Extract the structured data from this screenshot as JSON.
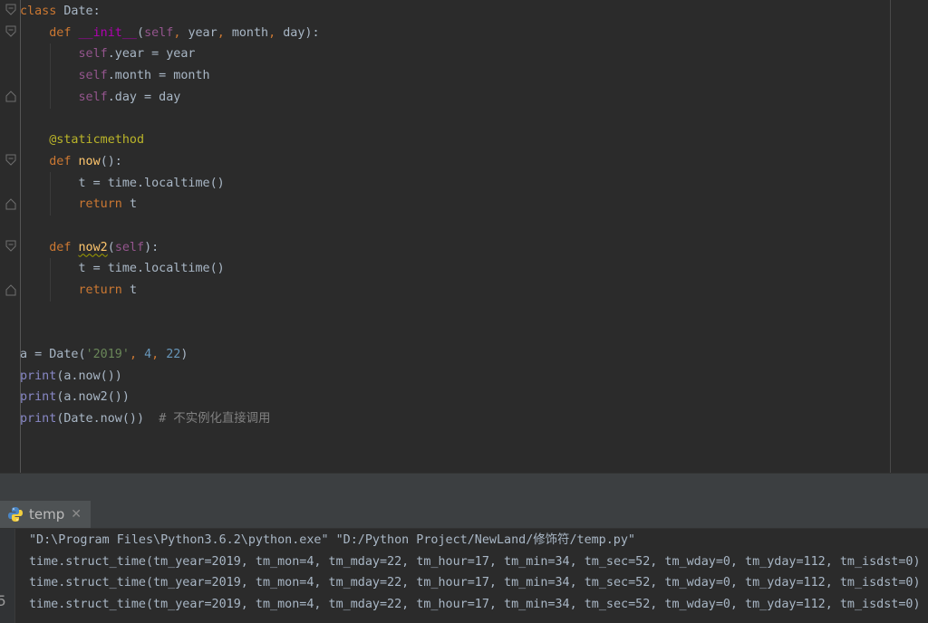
{
  "editor": {
    "lines": [
      [
        {
          "t": "class ",
          "c": "kw"
        },
        {
          "t": "Date:",
          "c": "txt"
        }
      ],
      [
        {
          "t": "    ",
          "c": "txt"
        },
        {
          "t": "def ",
          "c": "kw"
        },
        {
          "t": "__init__",
          "c": "magic"
        },
        {
          "t": "(",
          "c": "txt"
        },
        {
          "t": "self",
          "c": "self"
        },
        {
          "t": ", ",
          "c": "kw"
        },
        {
          "t": "year",
          "c": "txt"
        },
        {
          "t": ", ",
          "c": "kw"
        },
        {
          "t": "month",
          "c": "txt"
        },
        {
          "t": ", ",
          "c": "kw"
        },
        {
          "t": "day):",
          "c": "txt"
        }
      ],
      [
        {
          "t": "        ",
          "c": "txt"
        },
        {
          "t": "self",
          "c": "self"
        },
        {
          "t": ".year = year",
          "c": "txt"
        }
      ],
      [
        {
          "t": "        ",
          "c": "txt"
        },
        {
          "t": "self",
          "c": "self"
        },
        {
          "t": ".month = month",
          "c": "txt"
        }
      ],
      [
        {
          "t": "        ",
          "c": "txt"
        },
        {
          "t": "self",
          "c": "self"
        },
        {
          "t": ".day = day",
          "c": "txt"
        }
      ],
      [],
      [
        {
          "t": "    ",
          "c": "txt"
        },
        {
          "t": "@staticmethod",
          "c": "deco"
        }
      ],
      [
        {
          "t": "    ",
          "c": "txt"
        },
        {
          "t": "def ",
          "c": "kw"
        },
        {
          "t": "now",
          "c": "fn"
        },
        {
          "t": "():",
          "c": "txt"
        }
      ],
      [
        {
          "t": "        t = time.localtime()",
          "c": "txt"
        }
      ],
      [
        {
          "t": "        ",
          "c": "txt"
        },
        {
          "t": "return ",
          "c": "kw"
        },
        {
          "t": "t",
          "c": "txt"
        }
      ],
      [],
      [
        {
          "t": "    ",
          "c": "txt"
        },
        {
          "t": "def ",
          "c": "kw"
        },
        {
          "t": "now2",
          "c": "fn warn"
        },
        {
          "t": "(",
          "c": "txt"
        },
        {
          "t": "self",
          "c": "self"
        },
        {
          "t": "):",
          "c": "txt"
        }
      ],
      [
        {
          "t": "        t = time.localtime()",
          "c": "txt"
        }
      ],
      [
        {
          "t": "        ",
          "c": "txt"
        },
        {
          "t": "return ",
          "c": "kw"
        },
        {
          "t": "t",
          "c": "txt"
        }
      ],
      [],
      [],
      [
        {
          "t": "a = Date(",
          "c": "txt"
        },
        {
          "t": "'2019'",
          "c": "str"
        },
        {
          "t": ", ",
          "c": "kw"
        },
        {
          "t": "4",
          "c": "num"
        },
        {
          "t": ", ",
          "c": "kw"
        },
        {
          "t": "22",
          "c": "num"
        },
        {
          "t": ")",
          "c": "txt"
        }
      ],
      [
        {
          "t": "print",
          "c": "builtin"
        },
        {
          "t": "(a.now())",
          "c": "txt"
        }
      ],
      [
        {
          "t": "print",
          "c": "builtin"
        },
        {
          "t": "(a.now2())",
          "c": "txt"
        }
      ],
      [
        {
          "t": "print",
          "c": "builtin"
        },
        {
          "t": "(Date.now())  ",
          "c": "txt"
        },
        {
          "t": "# 不实例化直接调用",
          "c": "cmt"
        }
      ]
    ]
  },
  "run_panel": {
    "tab_label": "temp",
    "gutter_glyph": "5",
    "output": [
      "\"D:\\Program Files\\Python3.6.2\\python.exe\" \"D:/Python Project/NewLand/修饰符/temp.py\"",
      "time.struct_time(tm_year=2019, tm_mon=4, tm_mday=22, tm_hour=17, tm_min=34, tm_sec=52, tm_wday=0, tm_yday=112, tm_isdst=0)",
      "time.struct_time(tm_year=2019, tm_mon=4, tm_mday=22, tm_hour=17, tm_min=34, tm_sec=52, tm_wday=0, tm_yday=112, tm_isdst=0)",
      "time.struct_time(tm_year=2019, tm_mon=4, tm_mday=22, tm_hour=17, tm_min=34, tm_sec=52, tm_wday=0, tm_yday=112, tm_isdst=0)"
    ]
  },
  "colors": {
    "background": "#2b2b2b",
    "keyword": "#cc7832",
    "self": "#94558d",
    "function": "#ffc66d",
    "magic": "#b200b2",
    "decorator": "#bbb529",
    "number": "#6897bb",
    "string": "#6a8759",
    "builtin": "#8888c6",
    "comment": "#808080",
    "text": "#a9b7c6"
  }
}
